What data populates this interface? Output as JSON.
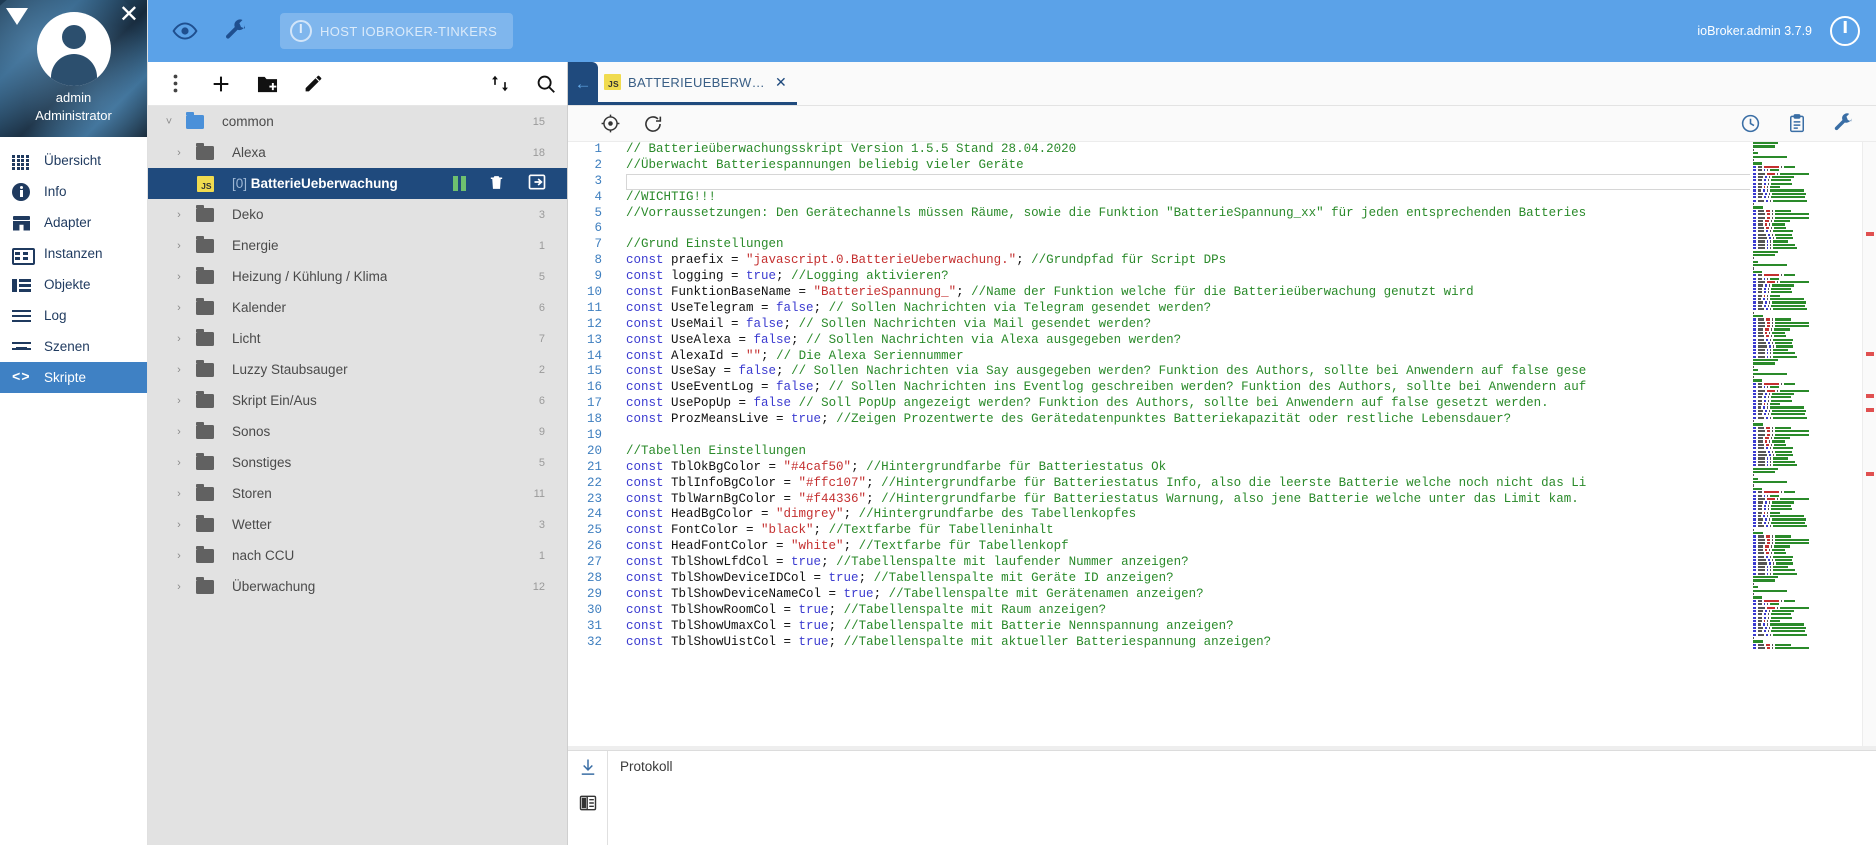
{
  "app": {
    "version_label": "ioBroker.admin 3.7.9",
    "host_chip": "HOST IOBROKER-TINKERS"
  },
  "drawer": {
    "user_name": "admin",
    "user_role": "Administrator",
    "close_icon": "close-icon",
    "logo_icon": "iobroker-logo-icon",
    "items": [
      {
        "label": "Übersicht",
        "icon": "grid-icon",
        "selected": false
      },
      {
        "label": "Info",
        "icon": "info-icon",
        "selected": false
      },
      {
        "label": "Adapter",
        "icon": "store-icon",
        "selected": false
      },
      {
        "label": "Instanzen",
        "icon": "instances-icon",
        "selected": false
      },
      {
        "label": "Objekte",
        "icon": "objects-list-icon",
        "selected": false
      },
      {
        "label": "Log",
        "icon": "log-lines-icon",
        "selected": false
      },
      {
        "label": "Szenen",
        "icon": "scenes-icon",
        "selected": false
      },
      {
        "label": "Skripte",
        "icon": "code-brackets-icon",
        "selected": true
      }
    ]
  },
  "topbar": {
    "eye_icon": "eye-icon",
    "wrench_icon": "wrench-icon",
    "power_icon": "power-icon"
  },
  "tree": {
    "toolbar": {
      "menu_icon": "more-vert-icon",
      "add_icon": "plus-icon",
      "new_folder_icon": "new-folder-icon",
      "edit_icon": "pencil-icon",
      "sort_icon": "sort-updown-icon",
      "search_icon": "search-icon"
    },
    "rows": [
      {
        "name": "common",
        "count": "15",
        "type": "folder-open",
        "depth": 0,
        "expanded": true,
        "selected": false
      },
      {
        "name": "Alexa",
        "count": "18",
        "type": "folder",
        "depth": 1,
        "expanded": false,
        "selected": false
      },
      {
        "name": "BatterieUeberwachung",
        "index": "[0]",
        "count": "",
        "type": "script",
        "depth": 1,
        "expanded": false,
        "selected": true
      },
      {
        "name": "Deko",
        "count": "3",
        "type": "folder",
        "depth": 1,
        "expanded": false,
        "selected": false
      },
      {
        "name": "Energie",
        "count": "1",
        "type": "folder",
        "depth": 1,
        "expanded": false,
        "selected": false
      },
      {
        "name": "Heizung / Kühlung / Klima",
        "count": "5",
        "type": "folder",
        "depth": 1,
        "expanded": false,
        "selected": false
      },
      {
        "name": "Kalender",
        "count": "6",
        "type": "folder",
        "depth": 1,
        "expanded": false,
        "selected": false
      },
      {
        "name": "Licht",
        "count": "7",
        "type": "folder",
        "depth": 1,
        "expanded": false,
        "selected": false
      },
      {
        "name": "Luzzy Staubsauger",
        "count": "2",
        "type": "folder",
        "depth": 1,
        "expanded": false,
        "selected": false
      },
      {
        "name": "Skript Ein/Aus",
        "count": "6",
        "type": "folder",
        "depth": 1,
        "expanded": false,
        "selected": false
      },
      {
        "name": "Sonos",
        "count": "9",
        "type": "folder",
        "depth": 1,
        "expanded": false,
        "selected": false
      },
      {
        "name": "Sonstiges",
        "count": "5",
        "type": "folder",
        "depth": 1,
        "expanded": false,
        "selected": false
      },
      {
        "name": "Storen",
        "count": "11",
        "type": "folder",
        "depth": 1,
        "expanded": false,
        "selected": false
      },
      {
        "name": "Wetter",
        "count": "3",
        "type": "folder",
        "depth": 1,
        "expanded": false,
        "selected": false
      },
      {
        "name": "nach CCU",
        "count": "1",
        "type": "folder",
        "depth": 1,
        "expanded": false,
        "selected": false
      },
      {
        "name": "Überwachung",
        "count": "12",
        "type": "folder",
        "depth": 1,
        "expanded": false,
        "selected": false
      }
    ],
    "selected_actions": {
      "pause_icon": "pause-icon",
      "delete_icon": "trash-icon",
      "export_icon": "export-arrow-icon"
    }
  },
  "editor": {
    "back_icon": "back-arrow-icon",
    "tab_label": "BATTERIEUEBERW…",
    "tab_close_icon": "close-icon",
    "tab_badge": "JS",
    "toolbar": {
      "locate_icon": "locate-target-icon",
      "reload_icon": "reload-icon",
      "history_icon": "clock-history-icon",
      "clipboard_icon": "clipboard-icon",
      "settings_icon": "wrench-icon"
    },
    "lines": [
      {
        "n": "1",
        "tokens": [
          [
            "cm",
            "// Batterieüberwachungsskript Version 1.5.5 Stand 28.04.2020"
          ]
        ]
      },
      {
        "n": "2",
        "tokens": [
          [
            "cm",
            "//Überwacht Batteriespannungen beliebig vieler Geräte"
          ]
        ]
      },
      {
        "n": "3",
        "tokens": [
          [
            "pl",
            ""
          ]
        ]
      },
      {
        "n": "4",
        "tokens": [
          [
            "cm",
            "//WICHTIG!!!"
          ]
        ]
      },
      {
        "n": "5",
        "tokens": [
          [
            "cm",
            "//Vorraussetzungen: Den Gerätechannels müssen Räume, sowie die Funktion \"BatterieSpannung_xx\" für jeden entsprechenden Batteries"
          ]
        ]
      },
      {
        "n": "6",
        "tokens": [
          [
            "pl",
            ""
          ]
        ]
      },
      {
        "n": "7",
        "tokens": [
          [
            "cm",
            "//Grund Einstellungen"
          ]
        ]
      },
      {
        "n": "8",
        "tokens": [
          [
            "kw",
            "const "
          ],
          [
            "pl",
            "praefix = "
          ],
          [
            "str",
            "\"javascript.0.BatterieUeberwachung.\""
          ],
          [
            "pl",
            "; "
          ],
          [
            "cm",
            "//Grundpfad für Script DPs"
          ]
        ]
      },
      {
        "n": "9",
        "tokens": [
          [
            "kw",
            "const "
          ],
          [
            "pl",
            "logging = "
          ],
          [
            "lit",
            "true"
          ],
          [
            "pl",
            "; "
          ],
          [
            "cm",
            "//Logging aktivieren?"
          ]
        ]
      },
      {
        "n": "10",
        "tokens": [
          [
            "kw",
            "const "
          ],
          [
            "pl",
            "FunktionBaseName = "
          ],
          [
            "str",
            "\"BatterieSpannung_\""
          ],
          [
            "pl",
            "; "
          ],
          [
            "cm",
            "//Name der Funktion welche für die Batterieüberwachung genutzt wird"
          ]
        ]
      },
      {
        "n": "11",
        "tokens": [
          [
            "kw",
            "const "
          ],
          [
            "pl",
            "UseTelegram = "
          ],
          [
            "lit",
            "false"
          ],
          [
            "pl",
            "; "
          ],
          [
            "cm",
            "// Sollen Nachrichten via Telegram gesendet werden?"
          ]
        ]
      },
      {
        "n": "12",
        "tokens": [
          [
            "kw",
            "const "
          ],
          [
            "pl",
            "UseMail = "
          ],
          [
            "lit",
            "false"
          ],
          [
            "pl",
            "; "
          ],
          [
            "cm",
            "// Sollen Nachrichten via Mail gesendet werden?"
          ]
        ]
      },
      {
        "n": "13",
        "tokens": [
          [
            "kw",
            "const "
          ],
          [
            "pl",
            "UseAlexa = "
          ],
          [
            "lit",
            "false"
          ],
          [
            "pl",
            "; "
          ],
          [
            "cm",
            "// Sollen Nachrichten via Alexa ausgegeben werden?"
          ]
        ]
      },
      {
        "n": "14",
        "tokens": [
          [
            "kw",
            "const "
          ],
          [
            "pl",
            "AlexaId = "
          ],
          [
            "str",
            "\"\""
          ],
          [
            "pl",
            "; "
          ],
          [
            "cm",
            "// Die Alexa Seriennummer"
          ]
        ]
      },
      {
        "n": "15",
        "tokens": [
          [
            "kw",
            "const "
          ],
          [
            "pl",
            "UseSay = "
          ],
          [
            "lit",
            "false"
          ],
          [
            "pl",
            "; "
          ],
          [
            "cm",
            "// Sollen Nachrichten via Say ausgegeben werden? Funktion des Authors, sollte bei Anwendern auf false gese"
          ]
        ]
      },
      {
        "n": "16",
        "tokens": [
          [
            "kw",
            "const "
          ],
          [
            "pl",
            "UseEventLog = "
          ],
          [
            "lit",
            "false"
          ],
          [
            "pl",
            "; "
          ],
          [
            "cm",
            "// Sollen Nachrichten ins Eventlog geschreiben werden? Funktion des Authors, sollte bei Anwendern auf"
          ]
        ]
      },
      {
        "n": "17",
        "tokens": [
          [
            "kw",
            "const "
          ],
          [
            "pl",
            "UsePopUp = "
          ],
          [
            "lit",
            "false"
          ],
          [
            "pl",
            " "
          ],
          [
            "cm",
            "// Soll PopUp angezeigt werden? Funktion des Authors, sollte bei Anwendern auf false gesetzt werden."
          ]
        ]
      },
      {
        "n": "18",
        "tokens": [
          [
            "kw",
            "const "
          ],
          [
            "pl",
            "ProzMeansLive = "
          ],
          [
            "lit",
            "true"
          ],
          [
            "pl",
            "; "
          ],
          [
            "cm",
            "//Zeigen Prozentwerte des Gerätedatenpunktes Batteriekapazität oder restliche Lebensdauer?"
          ]
        ]
      },
      {
        "n": "19",
        "tokens": [
          [
            "pl",
            ""
          ]
        ]
      },
      {
        "n": "20",
        "tokens": [
          [
            "cm",
            "//Tabellen Einstellungen"
          ]
        ]
      },
      {
        "n": "21",
        "tokens": [
          [
            "kw",
            "const "
          ],
          [
            "pl",
            "TblOkBgColor = "
          ],
          [
            "str",
            "\"#4caf50\""
          ],
          [
            "pl",
            "; "
          ],
          [
            "cm",
            "//Hintergrundfarbe für Batteriestatus Ok"
          ]
        ]
      },
      {
        "n": "22",
        "tokens": [
          [
            "kw",
            "const "
          ],
          [
            "pl",
            "TblInfoBgColor = "
          ],
          [
            "str",
            "\"#ffc107\""
          ],
          [
            "pl",
            "; "
          ],
          [
            "cm",
            "//Hintergrundfarbe für Batteriestatus Info, also die leerste Batterie welche noch nicht das Li"
          ]
        ]
      },
      {
        "n": "23",
        "tokens": [
          [
            "kw",
            "const "
          ],
          [
            "pl",
            "TblWarnBgColor = "
          ],
          [
            "str",
            "\"#f44336\""
          ],
          [
            "pl",
            "; "
          ],
          [
            "cm",
            "//Hintergrundfarbe für Batteriestatus Warnung, also jene Batterie welche unter das Limit kam."
          ]
        ]
      },
      {
        "n": "24",
        "tokens": [
          [
            "kw",
            "const "
          ],
          [
            "pl",
            "HeadBgColor = "
          ],
          [
            "str",
            "\"dimgrey\""
          ],
          [
            "pl",
            "; "
          ],
          [
            "cm",
            "//Hintergrundfarbe des Tabellenkopfes"
          ]
        ]
      },
      {
        "n": "25",
        "tokens": [
          [
            "kw",
            "const "
          ],
          [
            "pl",
            "FontColor = "
          ],
          [
            "str",
            "\"black\""
          ],
          [
            "pl",
            "; "
          ],
          [
            "cm",
            "//Textfarbe für Tabelleninhalt"
          ]
        ]
      },
      {
        "n": "26",
        "tokens": [
          [
            "kw",
            "const "
          ],
          [
            "pl",
            "HeadFontColor = "
          ],
          [
            "str",
            "\"white\""
          ],
          [
            "pl",
            "; "
          ],
          [
            "cm",
            "//Textfarbe für Tabellenkopf"
          ]
        ]
      },
      {
        "n": "27",
        "tokens": [
          [
            "kw",
            "const "
          ],
          [
            "pl",
            "TblShowLfdCol = "
          ],
          [
            "lit",
            "true"
          ],
          [
            "pl",
            "; "
          ],
          [
            "cm",
            "//Tabellenspalte mit laufender Nummer anzeigen?"
          ]
        ]
      },
      {
        "n": "28",
        "tokens": [
          [
            "kw",
            "const "
          ],
          [
            "pl",
            "TblShowDeviceIDCol = "
          ],
          [
            "lit",
            "true"
          ],
          [
            "pl",
            "; "
          ],
          [
            "cm",
            "//Tabellenspalte mit Geräte ID anzeigen?"
          ]
        ]
      },
      {
        "n": "29",
        "tokens": [
          [
            "kw",
            "const "
          ],
          [
            "pl",
            "TblShowDeviceNameCol = "
          ],
          [
            "lit",
            "true"
          ],
          [
            "pl",
            "; "
          ],
          [
            "cm",
            "//Tabellenspalte mit Gerätenamen anzeigen?"
          ]
        ]
      },
      {
        "n": "30",
        "tokens": [
          [
            "kw",
            "const "
          ],
          [
            "pl",
            "TblShowRoomCol = "
          ],
          [
            "lit",
            "true"
          ],
          [
            "pl",
            "; "
          ],
          [
            "cm",
            "//Tabellenspalte mit Raum anzeigen?"
          ]
        ]
      },
      {
        "n": "31",
        "tokens": [
          [
            "kw",
            "const "
          ],
          [
            "pl",
            "TblShowUmaxCol = "
          ],
          [
            "lit",
            "true"
          ],
          [
            "pl",
            "; "
          ],
          [
            "cm",
            "//Tabellenspalte mit Batterie Nennspannung anzeigen?"
          ]
        ]
      },
      {
        "n": "32",
        "tokens": [
          [
            "kw",
            "const "
          ],
          [
            "pl",
            "TblShowUistCol = "
          ],
          [
            "lit",
            "true"
          ],
          [
            "pl",
            "; "
          ],
          [
            "cm",
            "//Tabellenspalte mit aktueller Batteriespannung anzeigen?"
          ]
        ]
      }
    ]
  },
  "logpanel": {
    "title": "Protokoll",
    "download_icon": "download-icon",
    "layout_icon": "layout-columns-icon"
  },
  "colors": {
    "topbar": "#5ba2e8",
    "selection": "#1f4a7d",
    "tree_bg": "#e2e2e2",
    "comment": "#2a8a2a",
    "keyword": "#3b3bd0",
    "string": "#c43030",
    "linenumber": "#3f7fbf"
  }
}
